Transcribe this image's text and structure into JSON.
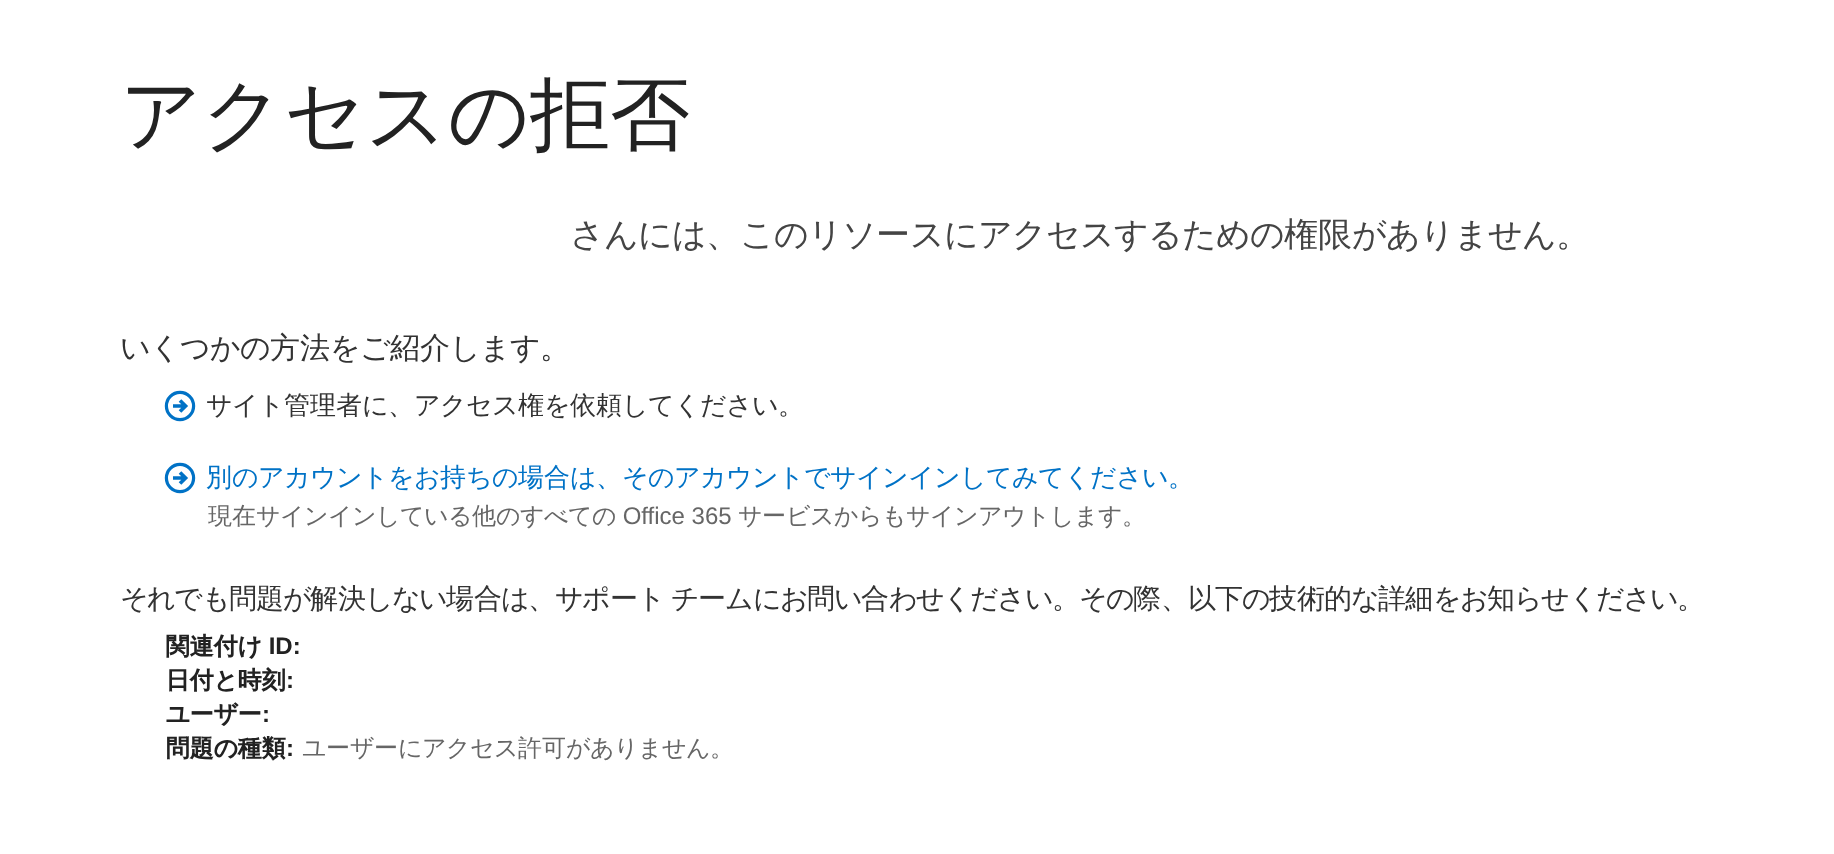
{
  "title": "アクセスの拒否",
  "message": "さんには、このリソースにアクセスするための権限がありません。",
  "options_intro": "いくつかの方法をご紹介します。",
  "options": [
    {
      "label": "サイト管理者に、アクセス権を依頼してください。"
    },
    {
      "label": "別のアカウントをお持ちの場合は、そのアカウントでサインインしてみてください。",
      "note": "現在サインインしている他のすべての Office 365 サービスからもサインアウトします。"
    }
  ],
  "support_text": "それでも問題が解決しない場合は、サポート チームにお問い合わせください。その際、以下の技術的な詳細をお知らせください。",
  "details": [
    {
      "label": "関連付け ID:"
    },
    {
      "label": "日付と時刻:"
    },
    {
      "label": "ユーザー:"
    },
    {
      "label": "問題の種類:",
      "value": "ユーザーにアクセス許可がありません。"
    }
  ]
}
